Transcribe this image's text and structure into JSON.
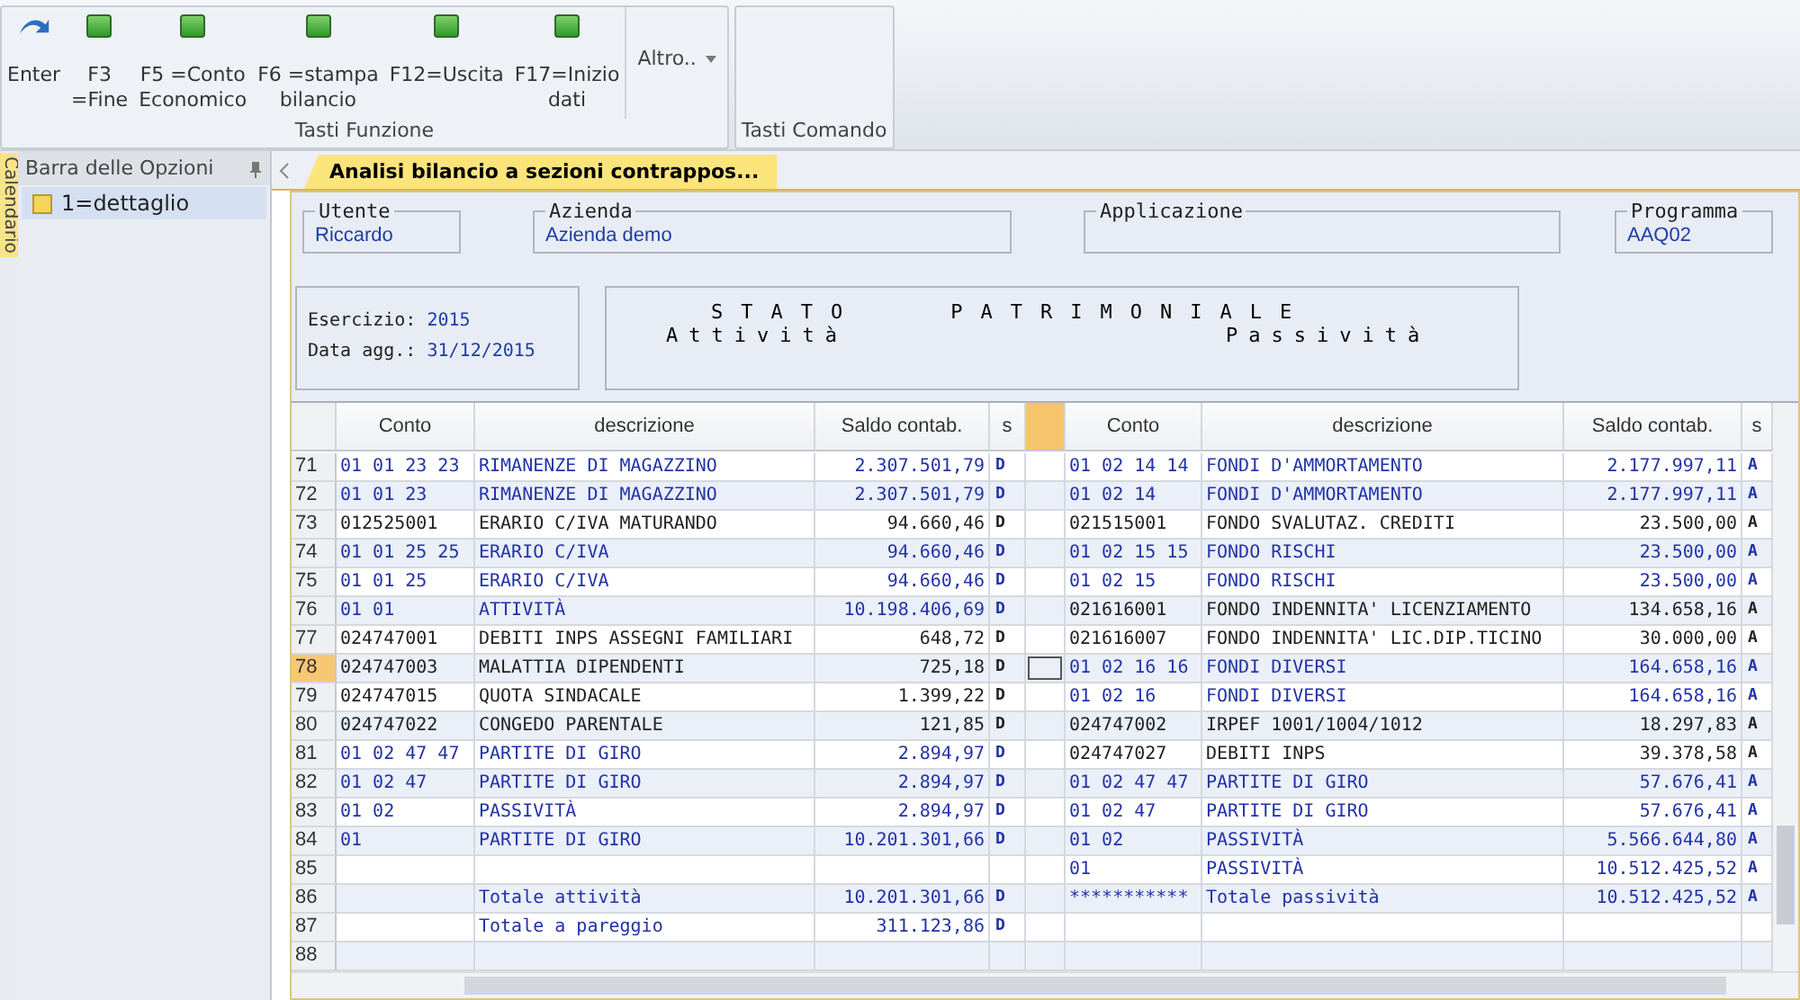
{
  "ribbon": {
    "groups": [
      {
        "label": "Tasti Funzione",
        "more": "Altro..",
        "buttons": [
          {
            "label": "Enter",
            "kind": "enter"
          },
          {
            "label": "F3\n=Fine",
            "kind": "function"
          },
          {
            "label": "F5  =Conto\nEconomico",
            "kind": "function"
          },
          {
            "label": "F6  =stampa\nbilancio",
            "kind": "function"
          },
          {
            "label": "F12=Uscita",
            "kind": "function"
          },
          {
            "label": "F17=Inizio\ndati",
            "kind": "function"
          }
        ]
      },
      {
        "label": "Tasti Comando"
      }
    ]
  },
  "side_panel": {
    "vertical_tab": "Calendario",
    "title": "Barra delle Opzioni",
    "items": [
      {
        "label": "1=dettaglio",
        "selected": true
      }
    ]
  },
  "document_tab": {
    "label": "Analisi bilancio a sezioni contrappos...",
    "selected": true
  },
  "info_fields": [
    {
      "label": "Utente",
      "value": "Riccardo"
    },
    {
      "label": "Azienda",
      "value": "Azienda demo"
    },
    {
      "label": "Applicazione"
    },
    {
      "label": "Programma",
      "value": "AAQ02"
    }
  ],
  "period": {
    "esercizio_label": "Esercizio:",
    "esercizio": "2015",
    "data_label": "Data agg.:",
    "data": "31/12/2015"
  },
  "heading": {
    "title_1": "STATO",
    "title_2": "PATRIMONIALE",
    "left": "Attività",
    "right": "Passività"
  },
  "table": {
    "columns_left": [
      "Conto",
      "descrizione",
      "Saldo contab.",
      "s"
    ],
    "columns_right": [
      "Conto",
      "descrizione",
      "Saldo contab.",
      "s"
    ],
    "rows": [
      {
        "n": "71",
        "selected": false,
        "left": {
          "kind": "group",
          "conto": "01 01 23 23",
          "descr": "RIMANENZE DI MAGAZZINO",
          "saldo": "2.307.501,79",
          "s": "D"
        },
        "right": {
          "kind": "group",
          "conto": "01 02 14 14",
          "descr": "FONDI D'AMMORTAMENTO",
          "saldo": "2.177.997,11",
          "s": "A"
        }
      },
      {
        "n": "72",
        "selected": false,
        "left": {
          "kind": "group",
          "conto": "01 01 23",
          "descr": "RIMANENZE DI MAGAZZINO",
          "saldo": "2.307.501,79",
          "s": "D"
        },
        "right": {
          "kind": "group",
          "conto": "01 02 14",
          "descr": "FONDI D'AMMORTAMENTO",
          "saldo": "2.177.997,11",
          "s": "A"
        }
      },
      {
        "n": "73",
        "selected": false,
        "left": {
          "kind": "account",
          "conto": "012525001",
          "descr": "ERARIO C/IVA MATURANDO",
          "saldo": "94.660,46",
          "s": "D"
        },
        "right": {
          "kind": "account",
          "conto": "021515001",
          "descr": "FONDO SVALUTAZ. CREDITI",
          "saldo": "23.500,00",
          "s": "A"
        }
      },
      {
        "n": "74",
        "selected": false,
        "left": {
          "kind": "group",
          "conto": "01 01 25 25",
          "descr": "ERARIO C/IVA",
          "saldo": "94.660,46",
          "s": "D"
        },
        "right": {
          "kind": "group",
          "conto": "01 02 15 15",
          "descr": "FONDO RISCHI",
          "saldo": "23.500,00",
          "s": "A"
        }
      },
      {
        "n": "75",
        "selected": false,
        "left": {
          "kind": "group",
          "conto": "01 01 25",
          "descr": "ERARIO C/IVA",
          "saldo": "94.660,46",
          "s": "D"
        },
        "right": {
          "kind": "group",
          "conto": "01 02 15",
          "descr": "FONDO RISCHI",
          "saldo": "23.500,00",
          "s": "A"
        }
      },
      {
        "n": "76",
        "selected": false,
        "left": {
          "kind": "group",
          "conto": "01 01",
          "descr": "ATTIVITÀ",
          "saldo": "10.198.406,69",
          "s": "D"
        },
        "right": {
          "kind": "account",
          "conto": "021616001",
          "descr": "FONDO INDENNITA' LICENZIAMENTO",
          "saldo": "134.658,16",
          "s": "A"
        }
      },
      {
        "n": "77",
        "selected": false,
        "left": {
          "kind": "account",
          "conto": "024747001",
          "descr": "DEBITI INPS ASSEGNI FAMILIARI",
          "saldo": "648,72",
          "s": "D"
        },
        "right": {
          "kind": "account",
          "conto": "021616007",
          "descr": "FONDO INDENNITA' LIC.DIP.TICINO",
          "saldo": "30.000,00",
          "s": "A"
        }
      },
      {
        "n": "78",
        "selected": true,
        "left": {
          "kind": "account",
          "conto": "024747003",
          "descr": "MALATTIA DIPENDENTI",
          "saldo": "725,18",
          "s": "D"
        },
        "right": {
          "kind": "group",
          "conto": "01 02 16 16",
          "descr": "FONDI DIVERSI",
          "saldo": "164.658,16",
          "s": "A"
        }
      },
      {
        "n": "79",
        "selected": false,
        "left": {
          "kind": "account",
          "conto": "024747015",
          "descr": "QUOTA SINDACALE",
          "saldo": "1.399,22",
          "s": "D"
        },
        "right": {
          "kind": "group",
          "conto": "01 02 16",
          "descr": "FONDI DIVERSI",
          "saldo": "164.658,16",
          "s": "A"
        }
      },
      {
        "n": "80",
        "selected": false,
        "left": {
          "kind": "account",
          "conto": "024747022",
          "descr": "CONGEDO PARENTALE",
          "saldo": "121,85",
          "s": "D"
        },
        "right": {
          "kind": "account",
          "conto": "024747002",
          "descr": "IRPEF 1001/1004/1012",
          "saldo": "18.297,83",
          "s": "A"
        }
      },
      {
        "n": "81",
        "selected": false,
        "left": {
          "kind": "group",
          "conto": "01 02 47 47",
          "descr": "PARTITE DI GIRO",
          "saldo": "2.894,97",
          "s": "D"
        },
        "right": {
          "kind": "account",
          "conto": "024747027",
          "descr": "DEBITI INPS",
          "saldo": "39.378,58",
          "s": "A"
        }
      },
      {
        "n": "82",
        "selected": false,
        "left": {
          "kind": "group",
          "conto": "01 02 47",
          "descr": "PARTITE DI GIRO",
          "saldo": "2.894,97",
          "s": "D"
        },
        "right": {
          "kind": "group",
          "conto": "01 02 47 47",
          "descr": "PARTITE DI GIRO",
          "saldo": "57.676,41",
          "s": "A"
        }
      },
      {
        "n": "83",
        "selected": false,
        "left": {
          "kind": "group",
          "conto": "01 02",
          "descr": "PASSIVITÀ",
          "saldo": "2.894,97",
          "s": "D"
        },
        "right": {
          "kind": "group",
          "conto": "01 02 47",
          "descr": "PARTITE DI GIRO",
          "saldo": "57.676,41",
          "s": "A"
        }
      },
      {
        "n": "84",
        "selected": false,
        "left": {
          "kind": "group",
          "conto": "01",
          "descr": "PARTITE DI GIRO",
          "saldo": "10.201.301,66",
          "s": "D"
        },
        "right": {
          "kind": "group",
          "conto": "01 02",
          "descr": "PASSIVITÀ",
          "saldo": "5.566.644,80",
          "s": "A"
        }
      },
      {
        "n": "85",
        "selected": false,
        "right": {
          "kind": "group",
          "conto": "01",
          "descr": "PASSIVITÀ",
          "saldo": "10.512.425,52",
          "s": "A"
        }
      },
      {
        "n": "86",
        "selected": false,
        "left": {
          "kind": "group",
          "descr": "Totale attività",
          "saldo": "10.201.301,66",
          "s": "D"
        },
        "right": {
          "kind": "group",
          "conto": "***********",
          "descr": "Totale passività",
          "saldo": "10.512.425,52",
          "s": "A"
        }
      },
      {
        "n": "87",
        "selected": false,
        "left": {
          "kind": "group",
          "descr": "Totale a pareggio",
          "saldo": "311.123,86",
          "s": "D"
        }
      },
      {
        "n": "88",
        "selected": false
      }
    ]
  }
}
